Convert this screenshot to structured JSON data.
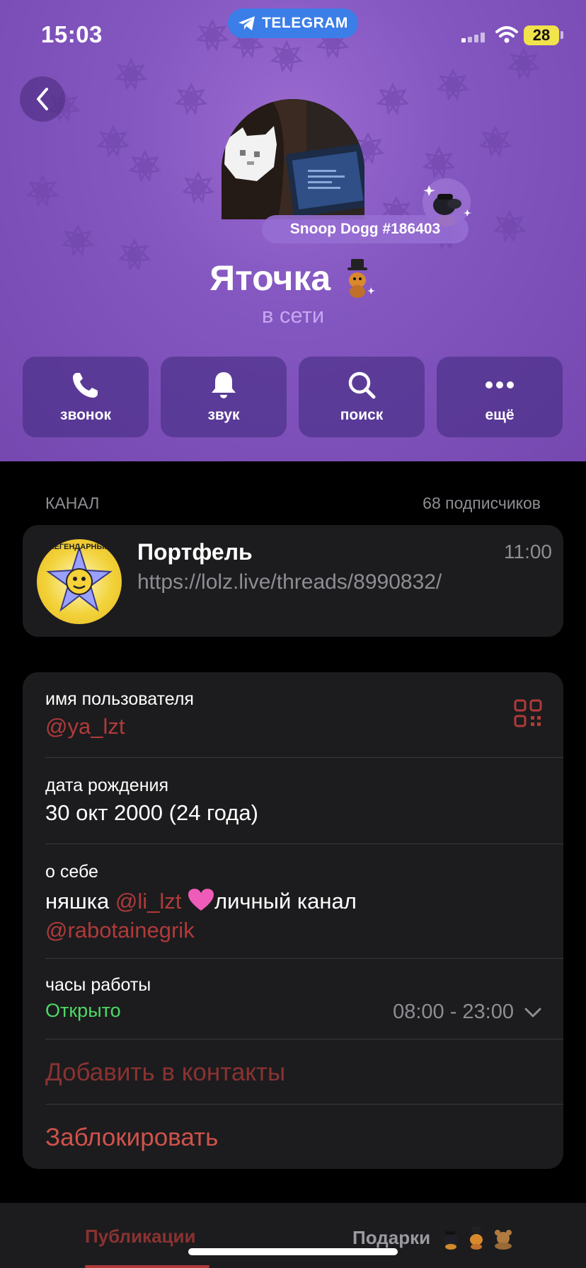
{
  "status_bar": {
    "time": "15:03",
    "pill_label": "TELEGRAM",
    "battery": "28"
  },
  "profile": {
    "gift_badge": "Snoop Dogg #186403",
    "name": "Яточка",
    "status": "в сети"
  },
  "actions": [
    {
      "label": "звонок",
      "icon": "phone-icon"
    },
    {
      "label": "звук",
      "icon": "bell-icon"
    },
    {
      "label": "поиск",
      "icon": "search-icon"
    },
    {
      "label": "ещё",
      "icon": "more-icon"
    }
  ],
  "channel_section": {
    "heading": "КАНАЛ",
    "subscribers": "68 подписчиков",
    "title": "Портфель",
    "time": "11:00",
    "link": "https://lolz.live/threads/8990832/",
    "avatar_text": "ЛЕГЕНДАРНЫЙ"
  },
  "info": {
    "username_label": "имя пользователя",
    "username": "@ya_lzt",
    "birthday_label": "дата рождения",
    "birthday": "30 окт 2000 (24 года)",
    "about_label": "о себе",
    "about_prefix": "няшка ",
    "about_mention": "@li_lzt",
    "about_middle": "личный канал",
    "about_channel": "@rabotainegrik",
    "hours_label": "часы работы",
    "hours_status": "Открыто",
    "hours_range": "08:00 - 23:00",
    "add_contact": "Добавить в контакты",
    "block": "Заблокировать"
  },
  "tabs": {
    "posts": "Публикации",
    "gifts": "Подарки"
  },
  "colors": {
    "header": "#8356c0",
    "accent": "#b03a3a",
    "open": "#4cd964",
    "card": "#1c1c1e"
  }
}
